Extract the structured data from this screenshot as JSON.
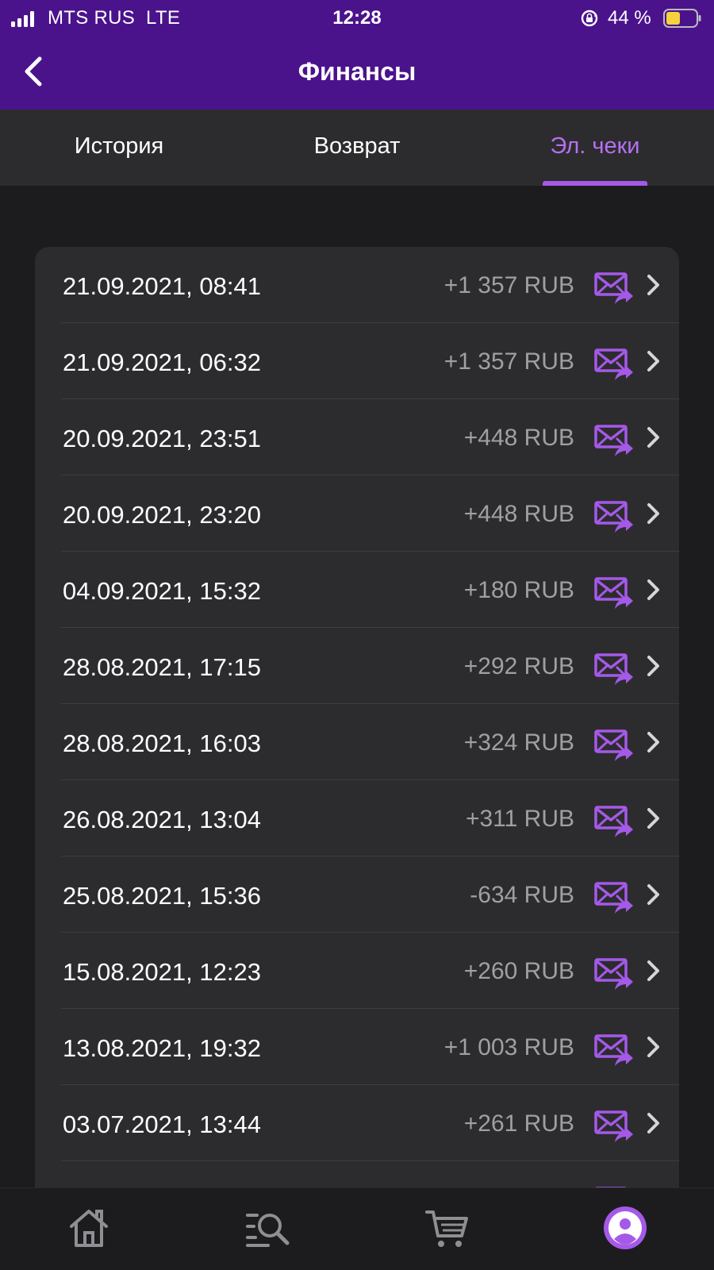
{
  "status_bar": {
    "carrier": "MTS RUS",
    "network": "LTE",
    "time": "12:28",
    "battery_percent": "44 %",
    "icons": [
      "signal-icon",
      "orientation-lock-icon",
      "battery-icon"
    ]
  },
  "header": {
    "title": "Финансы",
    "back_icon": "chevron-left-icon"
  },
  "tabs": [
    {
      "label": "История",
      "active": false
    },
    {
      "label": "Возврат",
      "active": false
    },
    {
      "label": "Эл. чеки",
      "active": true
    }
  ],
  "receipts": [
    {
      "date": "21.09.2021, 08:41",
      "amount": "+1 357 RUB"
    },
    {
      "date": "21.09.2021, 06:32",
      "amount": "+1 357 RUB"
    },
    {
      "date": "20.09.2021, 23:51",
      "amount": "+448 RUB"
    },
    {
      "date": "20.09.2021, 23:20",
      "amount": "+448 RUB"
    },
    {
      "date": "04.09.2021, 15:32",
      "amount": "+180 RUB"
    },
    {
      "date": "28.08.2021, 17:15",
      "amount": "+292 RUB"
    },
    {
      "date": "28.08.2021, 16:03",
      "amount": "+324 RUB"
    },
    {
      "date": "26.08.2021, 13:04",
      "amount": "+311 RUB"
    },
    {
      "date": "25.08.2021, 15:36",
      "amount": "-634 RUB"
    },
    {
      "date": "15.08.2021, 12:23",
      "amount": "+260 RUB"
    },
    {
      "date": "13.08.2021, 19:32",
      "amount": "+1 003 RUB"
    },
    {
      "date": "03.07.2021, 13:44",
      "amount": "+261 RUB"
    }
  ],
  "bottom_nav": [
    {
      "icon": "home-icon"
    },
    {
      "icon": "search-list-icon"
    },
    {
      "icon": "cart-icon"
    },
    {
      "icon": "profile-icon",
      "active": true
    }
  ],
  "colors": {
    "header_bg": "#4a138c",
    "accent": "#a559e8",
    "background": "#1c1c1e",
    "card_bg": "#2c2c2e"
  }
}
